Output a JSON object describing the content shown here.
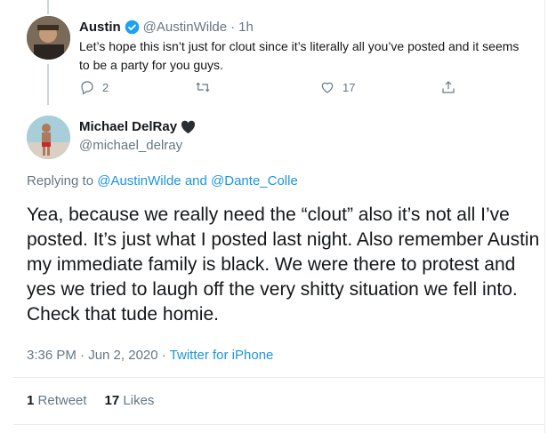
{
  "parent_tweet": {
    "name": "Austin",
    "handle": "@AustinWilde",
    "separator": "·",
    "time": "1h",
    "text": "Let’s hope this isn’t just for clout since it’s literally all you’ve posted and it seems to be a party for you guys.",
    "reply_count": "2",
    "retweet_count": "",
    "like_count": "17",
    "icons": [
      "reply-icon",
      "retweet-icon",
      "like-icon",
      "share-icon"
    ]
  },
  "main_tweet": {
    "name": "Michael DelRay",
    "handle": "@michael_delray",
    "replying_prefix": "Replying to",
    "replying_user1": "@AustinWilde",
    "replying_and": "and",
    "replying_user2": "@Dante_Colle",
    "text": "Yea, because we really need the “clout” also it’s not all I’ve posted. It’s just what I posted last night. Also remember Austin my immediate family is black. We were there to protest and yes we tried to laugh off the very shitty situation we fell into. Check that tude homie.",
    "timestamp": "3:36 PM · Jun 2, 2020 ·",
    "source": "Twitter for iPhone",
    "retweet_count": "1",
    "retweet_label": "Retweet",
    "like_count": "17",
    "like_label": "Likes"
  },
  "colors": {
    "link": "#1b95e0",
    "muted": "#657786",
    "text": "#14171a",
    "verified": "#1da1f2"
  }
}
